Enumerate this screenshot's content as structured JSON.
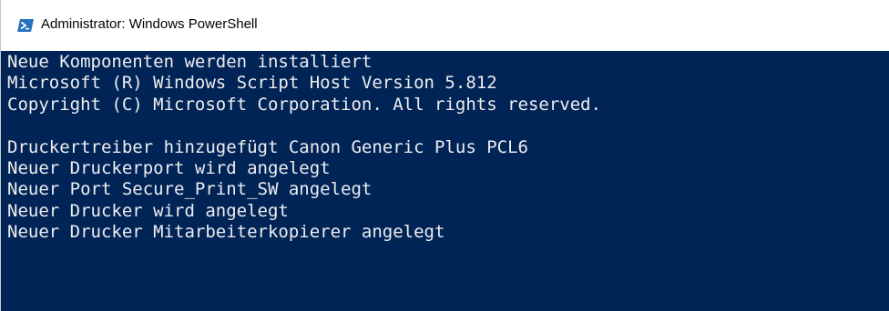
{
  "window": {
    "title": "Administrator: Windows PowerShell",
    "icon": "powershell-icon"
  },
  "console": {
    "background_color": "#012456",
    "text_color": "#eeedf0",
    "lines": [
      "Neue Komponenten werden installiert",
      "Microsoft (R) Windows Script Host Version 5.812",
      "Copyright (C) Microsoft Corporation. All rights reserved.",
      "",
      "Druckertreiber hinzugefügt Canon Generic Plus PCL6",
      "Neuer Druckerport wird angelegt",
      "Neuer Port Secure_Print_SW angelegt",
      "Neuer Drucker wird angelegt",
      "Neuer Drucker Mitarbeiterkopierer angelegt"
    ]
  }
}
